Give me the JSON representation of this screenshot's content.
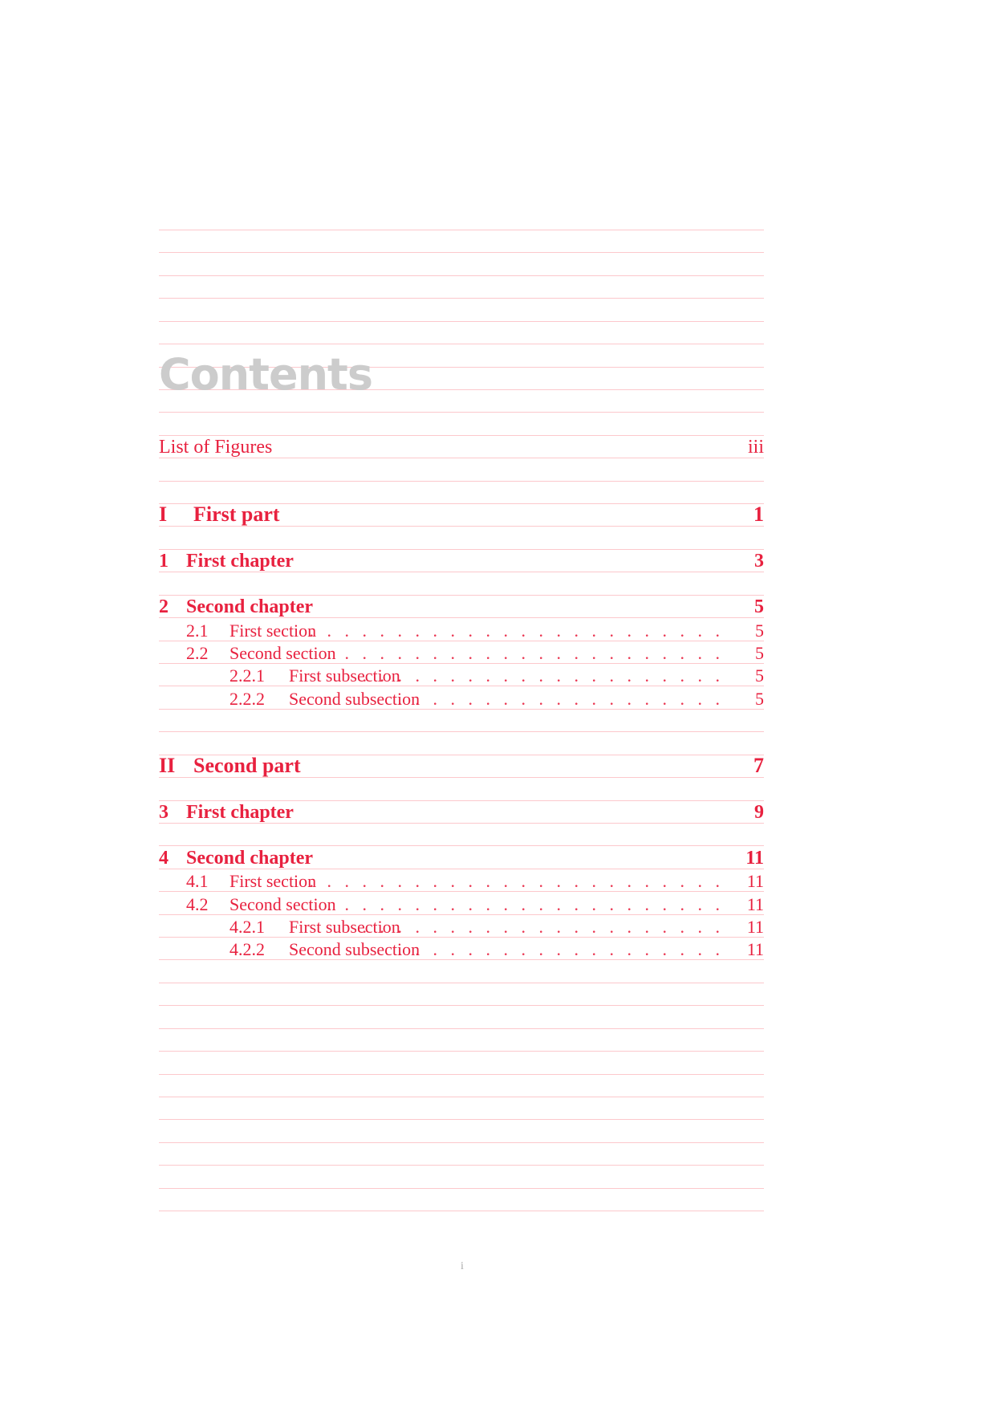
{
  "heading": "Contents",
  "entries": [
    {
      "level": "front",
      "number": "",
      "title": "List of Figures",
      "page": "iii"
    },
    {
      "level": "part",
      "number": "I",
      "title": "First part",
      "page": "1"
    },
    {
      "level": "chapter",
      "number": "1",
      "title": "First chapter",
      "page": "3"
    },
    {
      "level": "chapter",
      "number": "2",
      "title": "Second chapter",
      "page": "5"
    },
    {
      "level": "section",
      "number": "2.1",
      "title": "First section",
      "page": "5"
    },
    {
      "level": "section",
      "number": "2.2",
      "title": "Second section",
      "page": "5"
    },
    {
      "level": "subsection",
      "number": "2.2.1",
      "title": "First subsection",
      "page": "5"
    },
    {
      "level": "subsection",
      "number": "2.2.2",
      "title": "Second subsection",
      "page": "5"
    },
    {
      "level": "part",
      "number": "II",
      "title": "Second part",
      "page": "7"
    },
    {
      "level": "chapter",
      "number": "3",
      "title": "First chapter",
      "page": "9"
    },
    {
      "level": "chapter",
      "number": "4",
      "title": "Second chapter",
      "page": "11"
    },
    {
      "level": "section",
      "number": "4.1",
      "title": "First section",
      "page": "11"
    },
    {
      "level": "section",
      "number": "4.2",
      "title": "Second section",
      "page": "11"
    },
    {
      "level": "subsection",
      "number": "4.2.1",
      "title": "First subsection",
      "page": "11"
    },
    {
      "level": "subsection",
      "number": "4.2.2",
      "title": "Second subsection",
      "page": "11"
    }
  ],
  "page_number": "i",
  "colors": {
    "text": "#e8213f",
    "rules": "#fcc8cc",
    "heading": "#cccccc"
  }
}
